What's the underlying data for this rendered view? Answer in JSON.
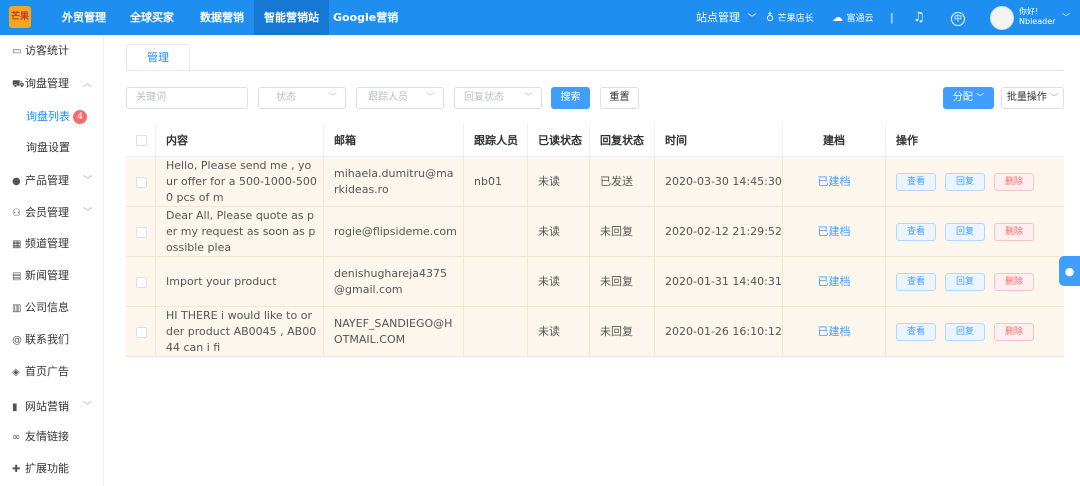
{
  "topbar": {
    "logo_text": "芒果",
    "nav": [
      "外贸管理",
      "全球买家",
      "数据营销",
      "智能营销站",
      "Google营销"
    ],
    "site_manage": "站点管理",
    "store": "芒果店长",
    "cloud": "富通云",
    "divider": "|",
    "lang_icon": "中",
    "greeting": "你好!",
    "username": "Nbleader"
  },
  "sidebar": {
    "items": [
      {
        "label": "访客统计",
        "icon": "monitor-icon",
        "glyph": "▭"
      },
      {
        "label": "询盘管理",
        "icon": "cart-icon",
        "glyph": "⛟",
        "expanded": true
      },
      {
        "label": "询盘列表",
        "sub": true,
        "active": true,
        "badge": "4"
      },
      {
        "label": "询盘设置",
        "sub": true
      },
      {
        "label": "产品管理",
        "icon": "product-icon",
        "glyph": "●"
      },
      {
        "label": "会员管理",
        "icon": "user-icon",
        "glyph": "⚇"
      },
      {
        "label": "频道管理",
        "icon": "channel-icon",
        "glyph": "▦"
      },
      {
        "label": "新闻管理",
        "icon": "news-icon",
        "glyph": "▤"
      },
      {
        "label": "公司信息",
        "icon": "company-icon",
        "glyph": "▥"
      },
      {
        "label": "联系我们",
        "icon": "at-icon",
        "glyph": "@"
      },
      {
        "label": "首页广告",
        "icon": "ad-icon",
        "glyph": "◈"
      },
      {
        "label": "网站营销",
        "icon": "chart-icon",
        "glyph": "▮"
      },
      {
        "label": "友情链接",
        "icon": "link-icon",
        "glyph": "∞"
      },
      {
        "label": "扩展功能",
        "icon": "puzzle-icon",
        "glyph": "✚"
      }
    ]
  },
  "tab": {
    "label": "管理"
  },
  "filters": {
    "keyword_placeholder": "关键词",
    "status_placeholder": "状态",
    "follower_placeholder": "跟踪人员",
    "reply_status_placeholder": "回复状态",
    "search_label": "搜索",
    "reset_label": "重置",
    "assign_label": "分配",
    "batch_label": "批量操作"
  },
  "table": {
    "headers": [
      "内容",
      "邮箱",
      "跟踪人员",
      "已读状态",
      "回复状态",
      "时间",
      "建档",
      "操作"
    ],
    "rows": [
      {
        "content": "Hello, Please send me , your offer for a 500-1000-5000 pcs of m",
        "email": "mihaela.dumitru@markideas.ro",
        "follower": "nb01",
        "read": "未读",
        "reply": "已发送",
        "time": "2020-03-30 14:45:30",
        "archive": "已建档"
      },
      {
        "content": "Dear All, Please quote as per my request as soon as possible plea",
        "email": "rogie@flipsideme.com",
        "follower": "",
        "read": "未读",
        "reply": "未回复",
        "time": "2020-02-12 21:29:52",
        "archive": "已建档"
      },
      {
        "content": "Import your product",
        "email": "denishughareja4375@gmail.com",
        "follower": "",
        "read": "未读",
        "reply": "未回复",
        "time": "2020-01-31 14:40:31",
        "archive": "已建档"
      },
      {
        "content": "HI THERE i would like to order product AB0045 , AB0044 can i fi",
        "email": "NAYEF_SANDIEGO@HOTMAIL.COM",
        "follower": "",
        "read": "未读",
        "reply": "未回复",
        "time": "2020-01-26 16:10:12",
        "archive": "已建档"
      }
    ],
    "actions": {
      "view": "查看",
      "reply": "回复",
      "delete": "删除"
    }
  },
  "colors": {
    "primary": "#1f8ef1",
    "row_bg": "#fdf6ec",
    "danger": "#f56c6c"
  }
}
